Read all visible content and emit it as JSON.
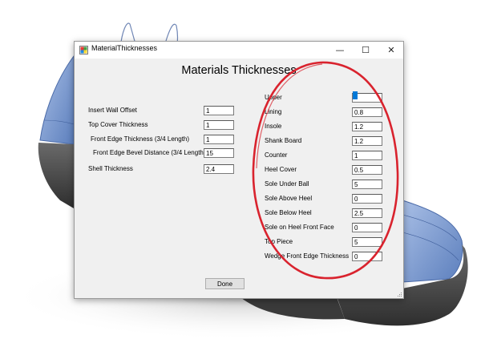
{
  "window": {
    "title": "MaterialThicknesses",
    "heading": "Materials Thicknesses",
    "controls": {
      "minimize": "—",
      "maximize": "☐",
      "close": "✕"
    }
  },
  "left_fields": [
    {
      "label": "Insert Wall Offset",
      "value": "1"
    },
    {
      "label": "Top Cover Thickness",
      "value": "1"
    },
    {
      "label": "Front Edge Thickness (3/4 Length)",
      "value": "1"
    },
    {
      "label": "Front Edge Bevel Distance (3/4 Length)",
      "value": "15"
    },
    {
      "label": "Shell Thickness",
      "value": "2.4"
    }
  ],
  "right_fields": [
    {
      "label": "Upper",
      "value": "1"
    },
    {
      "label": "Lining",
      "value": "0.8"
    },
    {
      "label": "Insole",
      "value": "1.2"
    },
    {
      "label": "Shank Board",
      "value": "1.2"
    },
    {
      "label": "Counter",
      "value": "1"
    },
    {
      "label": "Heel Cover",
      "value": "0.5"
    },
    {
      "label": "Sole Under Ball",
      "value": "5"
    },
    {
      "label": "Sole Above Heel",
      "value": "0"
    },
    {
      "label": "Sole Below Heel",
      "value": "2.5"
    },
    {
      "label": "Sole on Heel Front Face",
      "value": "0"
    },
    {
      "label": "Top Piece",
      "value": "5"
    },
    {
      "label": "Wedge Front Edge Thickness",
      "value": "0"
    }
  ],
  "done_label": "Done",
  "colors": {
    "shoe_blue": "#7f9fd3",
    "sole_dark": "#4a4a4a",
    "annotation_red": "#d9232e",
    "selection": "#0078d7"
  },
  "icons": {
    "app": "app-window-icon",
    "grip": "resize-grip-icon"
  }
}
